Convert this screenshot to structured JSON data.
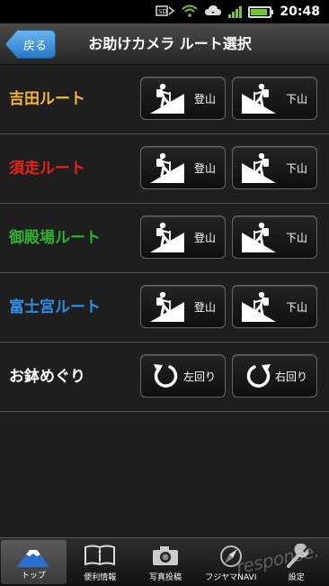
{
  "status_bar": {
    "time": "20:48"
  },
  "header": {
    "back_label": "戻る",
    "title": "お助けカメラ ルート選択"
  },
  "routes": [
    {
      "name": "吉田ルート",
      "color": "#f5b63a",
      "up": "登山",
      "down": "下山"
    },
    {
      "name": "須走ルート",
      "color": "#e8211d",
      "up": "登山",
      "down": "下山"
    },
    {
      "name": "御殿場ルート",
      "color": "#2fb22f",
      "up": "登山",
      "down": "下山"
    },
    {
      "name": "富士宮ルート",
      "color": "#2f8ee4",
      "up": "登山",
      "down": "下山"
    }
  ],
  "ohachi": {
    "name": "お鉢めぐり",
    "color": "#ffffff",
    "left": "左回り",
    "right": "右回り"
  },
  "bottom_nav": [
    {
      "label": "トップ",
      "icon": "fuji-icon",
      "active": true
    },
    {
      "label": "便利情報",
      "icon": "info-book-icon"
    },
    {
      "label": "写真投稿",
      "icon": "camera-icon"
    },
    {
      "label": "フジヤマNAVI",
      "icon": "compass-icon"
    },
    {
      "label": "設定",
      "icon": "wrench-icon"
    }
  ],
  "watermark": "response."
}
